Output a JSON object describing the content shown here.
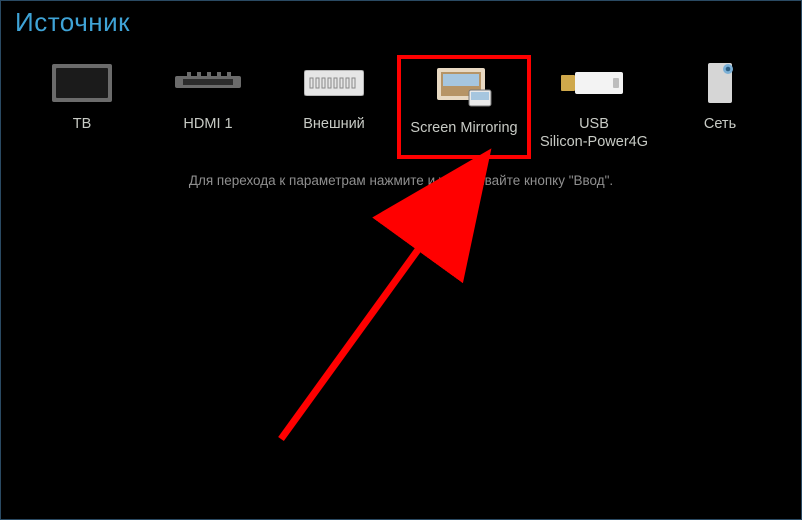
{
  "page_title": "Источник",
  "hint_text": "Для перехода к параметрам нажмите и удерживайте кнопку \"Ввод\".",
  "sources": [
    {
      "id": "tv",
      "label": "ТВ",
      "icon": "tv-icon"
    },
    {
      "id": "hdmi1",
      "label": "HDMI 1",
      "icon": "hdmi-icon"
    },
    {
      "id": "external",
      "label": "Внешний",
      "icon": "external-port-icon"
    },
    {
      "id": "screenmirror",
      "label": "Screen Mirroring",
      "icon": "screen-mirroring-icon",
      "highlighted": true
    },
    {
      "id": "usb",
      "label": "USB\nSilicon-Power4G",
      "icon": "usb-drive-icon"
    },
    {
      "id": "network",
      "label": "Сеть",
      "icon": "network-icon"
    }
  ],
  "annotation": {
    "arrow_color": "#ff0000",
    "highlight_color": "#ff0000"
  }
}
